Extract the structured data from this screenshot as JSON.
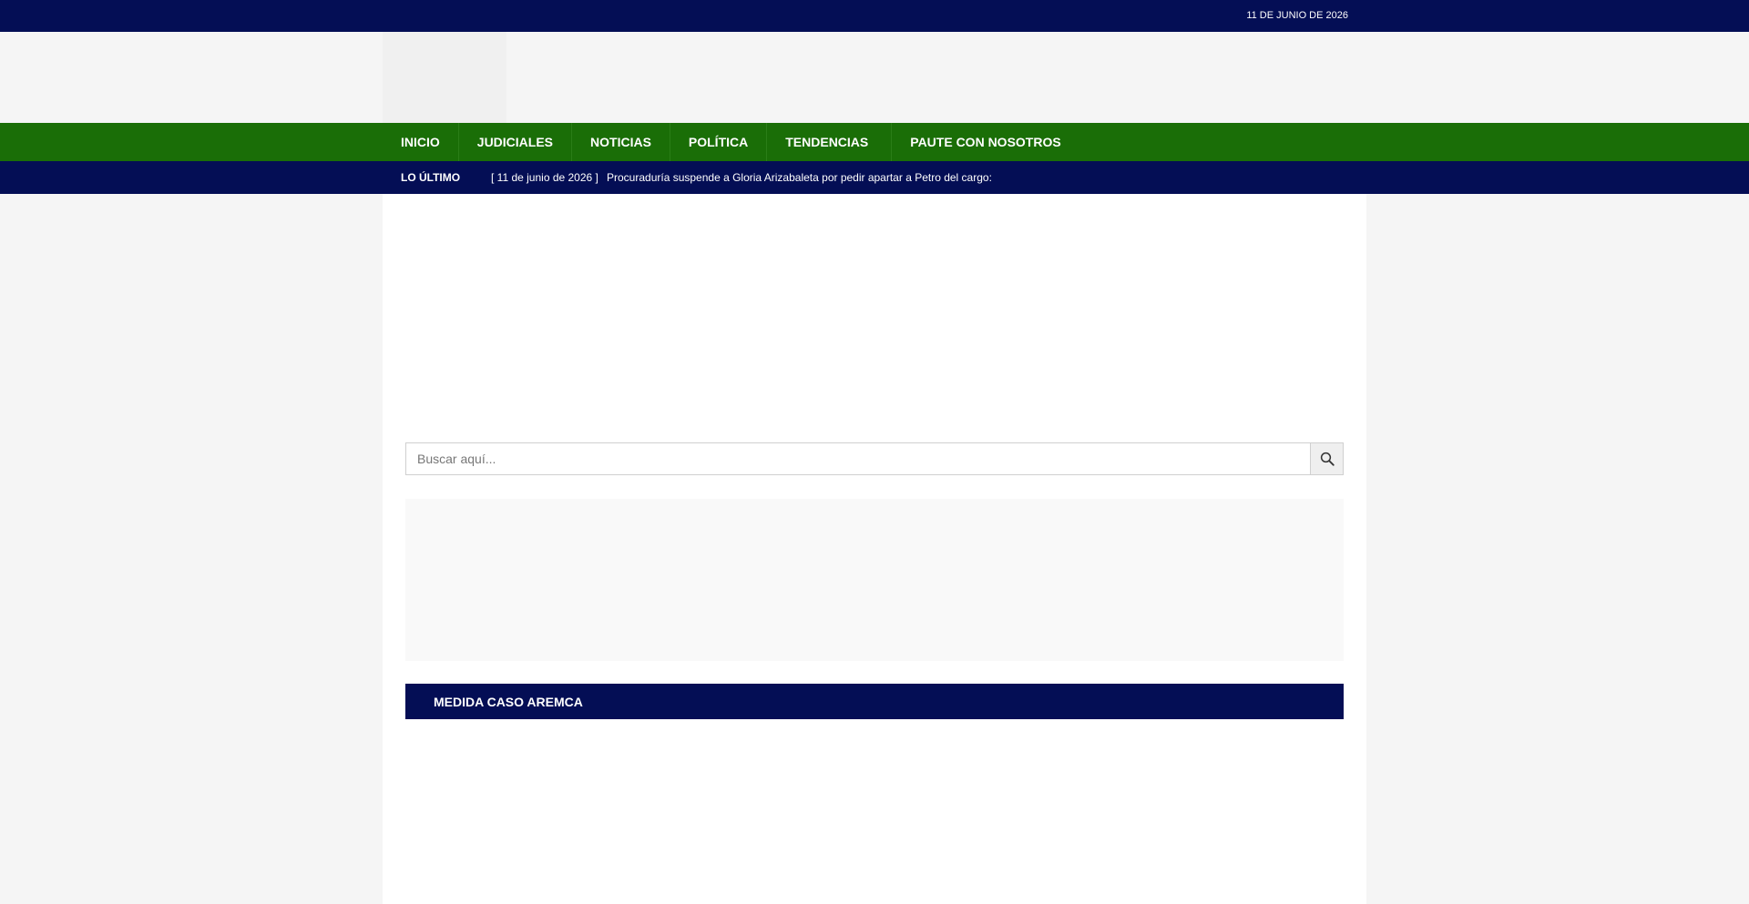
{
  "topbar": {
    "date": "11 DE JUNIO DE 2026"
  },
  "nav": {
    "items": [
      {
        "label": "INICIO"
      },
      {
        "label": "JUDICIALES"
      },
      {
        "label": "NOTICIAS"
      },
      {
        "label": "POLÍTICA"
      },
      {
        "label": "TENDENCIAS",
        "caret": ""
      },
      {
        "label": "PAUTE CON NOSOTROS"
      }
    ]
  },
  "ticker": {
    "label": "LO ÚLTIMO",
    "arrow": "",
    "date": "[ 11 de junio de 2026 ]",
    "headline": "Procuraduría suspende a Gloria Arizabaleta por pedir apartar a Petro del cargo:"
  },
  "social": {
    "icons": [
      "facebook-icon",
      "twitter-icon",
      "youtube-icon",
      "instagram-icon",
      "whatsapp-icon",
      "telegram-icon"
    ],
    "glyphs": [
      "",
      "",
      "",
      "",
      "",
      ""
    ]
  },
  "search": {
    "placeholder": "Buscar aquí..."
  },
  "section": {
    "icon": "",
    "title": "MEDIDA CASO AREMCA"
  },
  "colors": {
    "topbar": "#040e55",
    "nav": "#1a6e07",
    "page_bg": "#f5f5f5"
  }
}
